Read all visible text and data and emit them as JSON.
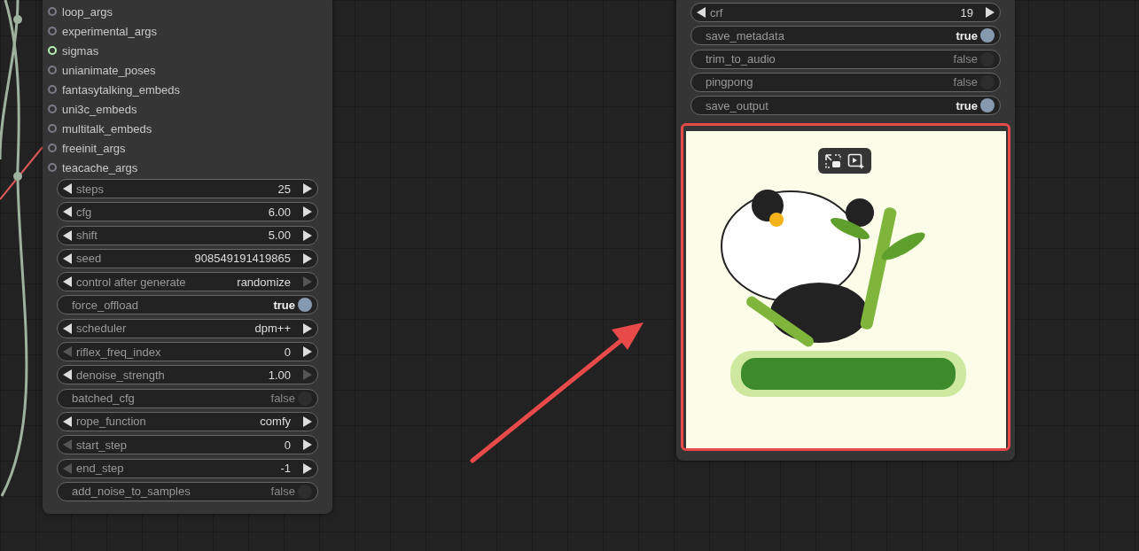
{
  "left_node": {
    "inputs": [
      {
        "name": "loop_args",
        "connected": false
      },
      {
        "name": "experimental_args",
        "connected": false
      },
      {
        "name": "sigmas",
        "connected": true
      },
      {
        "name": "unianimate_poses",
        "connected": false
      },
      {
        "name": "fantasytalking_embeds",
        "connected": false
      },
      {
        "name": "uni3c_embeds",
        "connected": false
      },
      {
        "name": "multitalk_embeds",
        "connected": false
      },
      {
        "name": "freeinit_args",
        "connected": false
      },
      {
        "name": "teacache_args",
        "connected": false
      }
    ],
    "widgets": [
      {
        "kind": "number",
        "label": "steps",
        "value": "25",
        "dec_enabled": true,
        "inc_enabled": true
      },
      {
        "kind": "number",
        "label": "cfg",
        "value": "6.00",
        "dec_enabled": true,
        "inc_enabled": true
      },
      {
        "kind": "number",
        "label": "shift",
        "value": "5.00",
        "dec_enabled": true,
        "inc_enabled": true
      },
      {
        "kind": "number",
        "label": "seed",
        "value": "908549191419865",
        "dec_enabled": true,
        "inc_enabled": true
      },
      {
        "kind": "number",
        "label": "control after generate",
        "value": "randomize",
        "dec_enabled": true,
        "inc_enabled": false
      },
      {
        "kind": "toggle",
        "label": "force_offload",
        "value": "true",
        "on": true
      },
      {
        "kind": "number",
        "label": "scheduler",
        "value": "dpm++",
        "dec_enabled": true,
        "inc_enabled": true
      },
      {
        "kind": "number",
        "label": "riflex_freq_index",
        "value": "0",
        "dec_enabled": false,
        "inc_enabled": true
      },
      {
        "kind": "number",
        "label": "denoise_strength",
        "value": "1.00",
        "dec_enabled": true,
        "inc_enabled": false
      },
      {
        "kind": "toggle",
        "label": "batched_cfg",
        "value": "false",
        "on": false
      },
      {
        "kind": "number",
        "label": "rope_function",
        "value": "comfy",
        "dec_enabled": true,
        "inc_enabled": true
      },
      {
        "kind": "number",
        "label": "start_step",
        "value": "0",
        "dec_enabled": false,
        "inc_enabled": true
      },
      {
        "kind": "number",
        "label": "end_step",
        "value": "-1",
        "dec_enabled": false,
        "inc_enabled": true
      },
      {
        "kind": "toggle",
        "label": "add_noise_to_samples",
        "value": "false",
        "on": false
      }
    ]
  },
  "right_node": {
    "widgets": [
      {
        "kind": "number",
        "label": "crf",
        "value": "19",
        "dec_enabled": true,
        "inc_enabled": true
      },
      {
        "kind": "toggle",
        "label": "save_metadata",
        "value": "true",
        "on": true
      },
      {
        "kind": "toggle",
        "label": "trim_to_audio",
        "value": "false",
        "on": false
      },
      {
        "kind": "toggle",
        "label": "pingpong",
        "value": "false",
        "on": false
      },
      {
        "kind": "toggle",
        "label": "save_output",
        "value": "true",
        "on": true
      }
    ],
    "preview": {
      "kind": "picture",
      "selected": true
    }
  }
}
